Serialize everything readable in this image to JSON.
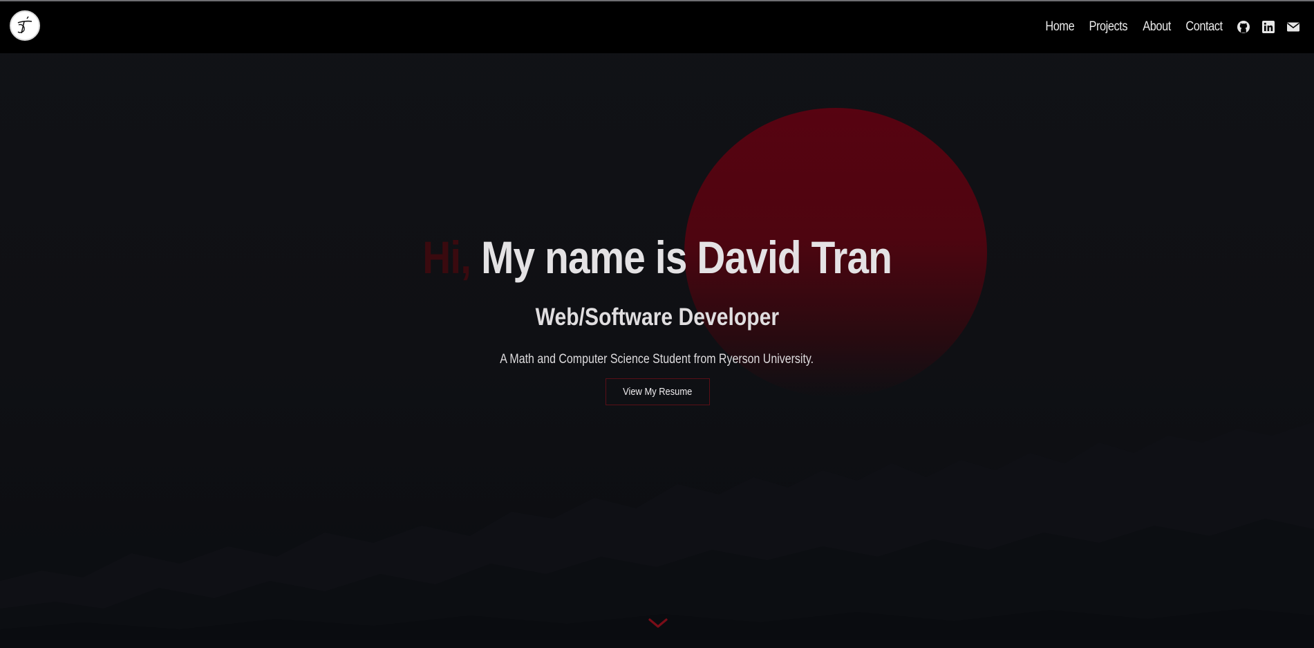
{
  "navbar": {
    "logo_icon": "dt-monogram-logo-icon",
    "links": [
      {
        "label": "Home"
      },
      {
        "label": "Projects"
      },
      {
        "label": "About"
      },
      {
        "label": "Contact"
      }
    ],
    "icons": [
      "github-icon",
      "linkedin-icon",
      "envelope-icon"
    ]
  },
  "hero": {
    "greeting": "Hi,",
    "title": "My name is David Tran",
    "subtitle": "Web/Software Developer",
    "description": "A Math and Computer Science Student from Ryerson University.",
    "resume_button": "View My Resume",
    "scroll_icon": "chevron-down-icon"
  },
  "colors": {
    "accent": "#8b0f1c",
    "greeting": "#3a0a0f",
    "sun": "#570311",
    "navbar_bg": "#000000",
    "text": "#e4e2e4"
  }
}
